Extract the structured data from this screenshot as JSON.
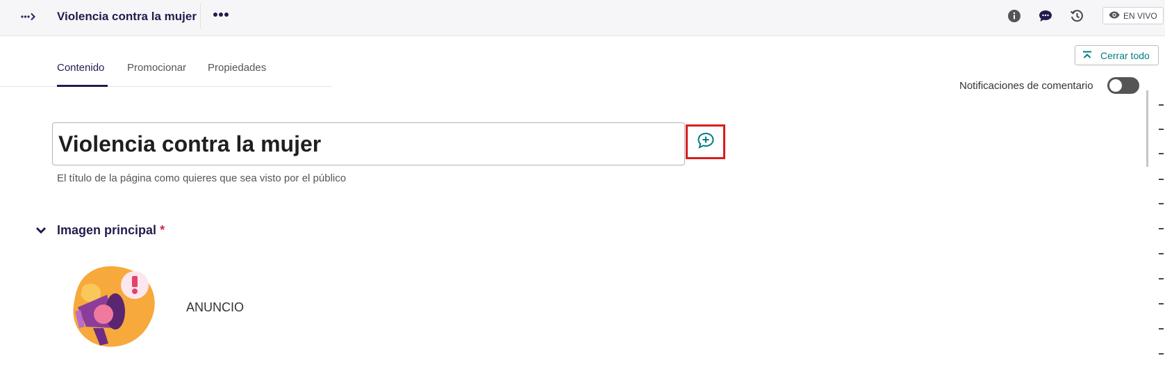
{
  "header": {
    "title": "Violencia contra la mujer",
    "status_label": "EN VIVO"
  },
  "icons": {
    "breadcrumb": "breadcrumb-toggle-icon",
    "more": "more-actions-icon",
    "info": "info-icon",
    "comments": "comments-icon",
    "history": "history-icon",
    "eye": "eye-icon"
  },
  "tabs": [
    {
      "label": "Contenido",
      "active": true
    },
    {
      "label": "Promocionar",
      "active": false
    },
    {
      "label": "Propiedades",
      "active": false
    }
  ],
  "collapse_all_label": "Cerrar todo",
  "comment_notifications": {
    "label": "Notificaciones de comentario",
    "enabled": false
  },
  "title_field": {
    "value": "Violencia contra la mujer",
    "help_text": "El título de la página como quieres que sea visto por el público"
  },
  "main_image": {
    "label": "Imagen principal",
    "required_mark": "*",
    "caption": "ANUNCIO"
  },
  "colors": {
    "brand": "#261a4d",
    "accent": "#007d7e",
    "highlight": "#d81d1d"
  }
}
